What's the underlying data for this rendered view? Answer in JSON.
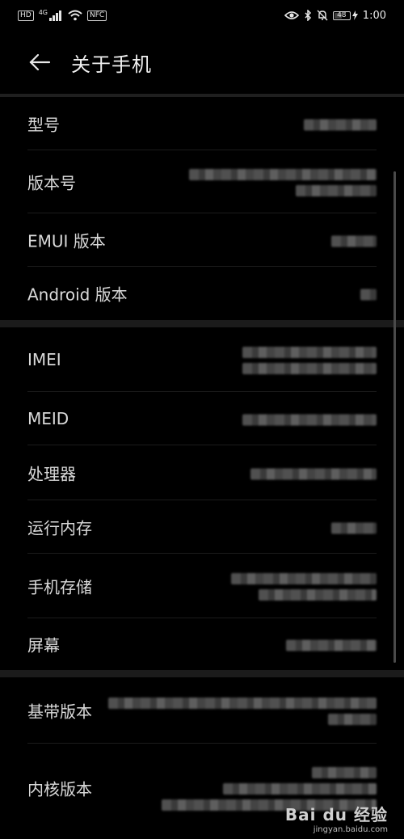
{
  "status_bar": {
    "left_tags": [
      "HD",
      "4G",
      "NFC"
    ],
    "battery": "48",
    "time": "1:00"
  },
  "header": {
    "title": "关于手机"
  },
  "sections": [
    {
      "rows": [
        {
          "label": "型号"
        },
        {
          "label": "版本号"
        },
        {
          "label": "EMUI 版本"
        },
        {
          "label": "Android 版本"
        }
      ]
    },
    {
      "rows": [
        {
          "label": "IMEI"
        },
        {
          "label": "MEID"
        },
        {
          "label": "处理器"
        },
        {
          "label": "运行内存"
        },
        {
          "label": "手机存储"
        },
        {
          "label": "屏幕"
        }
      ]
    },
    {
      "rows": [
        {
          "label": "基带版本"
        },
        {
          "label": "内核版本"
        }
      ]
    }
  ],
  "watermark": {
    "main": "Bai du 经验",
    "sub": "jingyan.baidu.com"
  },
  "colors": {
    "background": "#000000",
    "text_primary": "#d9d9d9",
    "divider": "#1c1c1c",
    "section_gap": "#1b1b1b"
  },
  "icons": {
    "back": "arrow-left-icon",
    "signal": "signal-bars-icon",
    "wifi": "wifi-icon",
    "eye": "eye-comfort-icon",
    "bluetooth": "bluetooth-icon",
    "mute": "bell-off-icon",
    "charging": "charging-bolt-icon"
  }
}
